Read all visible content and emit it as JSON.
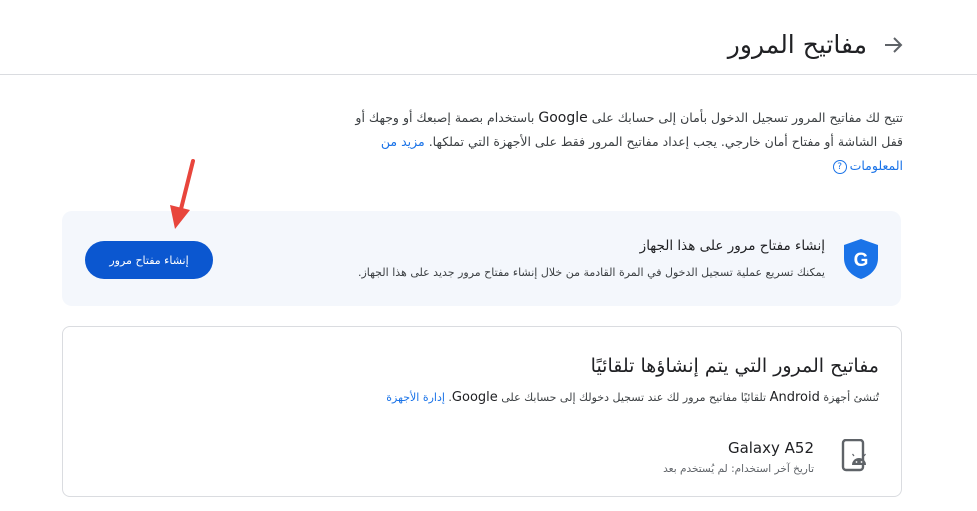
{
  "header": {
    "title": "مفاتيح المرور",
    "back_icon": "arrow-back-icon"
  },
  "intro": {
    "part1": "تتيح لك مفاتيح المرور تسجيل الدخول بأمان إلى حسابك على ",
    "brand": "Google",
    "part2": " باستخدام بصمة إصبعك أو وجهك أو قفل الشاشة أو مفتاح أمان خارجي. يجب إعداد مفاتيح المرور فقط على الأجهزة التي تملكها. ",
    "learn_more": "مزيد من المعلومات"
  },
  "create_card": {
    "title": "إنشاء مفتاح مرور على هذا الجهاز",
    "description": "يمكنك تسريع عملية تسجيل الدخول في المرة القادمة من خلال إنشاء مفتاح مرور جديد على هذا الجهاز.",
    "button_label": "إنشاء مفتاح مرور",
    "icon": "google-shield-icon",
    "icon_letter": "G",
    "button_color": "#0b57d0"
  },
  "annotation": {
    "arrow_color": "#e8453c"
  },
  "auto_card": {
    "title": "مفاتيح المرور التي يتم إنشاؤها تلقائيًا",
    "desc_part1": "تُنشئ أجهزة ",
    "desc_brand1": "Android",
    "desc_part2": " تلقائيًا مفاتيح مرور لك عند تسجيل دخولك إلى حسابك على ",
    "desc_brand2": "Google",
    "desc_part3": ". ",
    "manage_link": "إدارة الأجهزة",
    "device": {
      "name": "Galaxy A52",
      "last_used": "تاريخ آخر استخدام: لم يُستخدم بعد",
      "icon": "android-phone-icon"
    }
  },
  "colors": {
    "link": "#1a73e8",
    "card_bg": "#f4f7fc"
  }
}
